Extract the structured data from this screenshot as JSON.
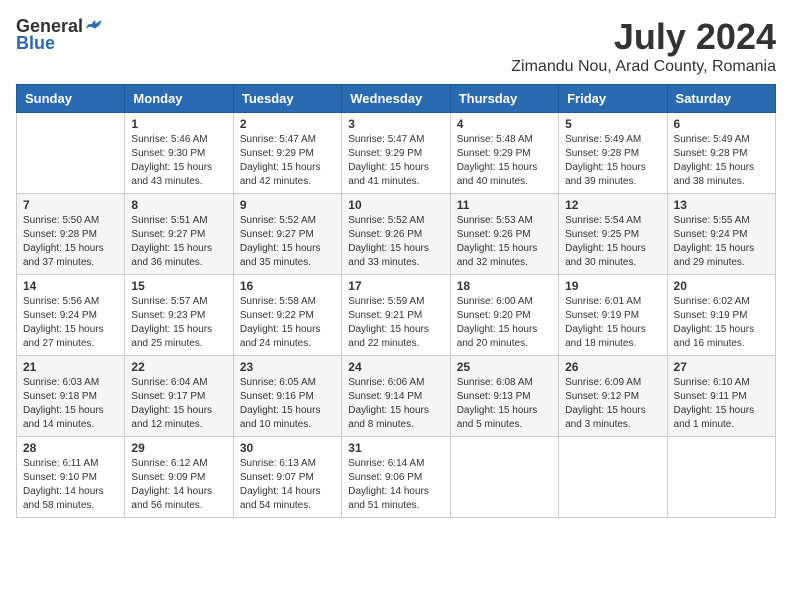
{
  "logo": {
    "general": "General",
    "blue": "Blue"
  },
  "title": {
    "month": "July 2024",
    "location": "Zimandu Nou, Arad County, Romania"
  },
  "weekdays": [
    "Sunday",
    "Monday",
    "Tuesday",
    "Wednesday",
    "Thursday",
    "Friday",
    "Saturday"
  ],
  "weeks": [
    [
      {
        "num": "",
        "info": ""
      },
      {
        "num": "1",
        "info": "Sunrise: 5:46 AM\nSunset: 9:30 PM\nDaylight: 15 hours\nand 43 minutes."
      },
      {
        "num": "2",
        "info": "Sunrise: 5:47 AM\nSunset: 9:29 PM\nDaylight: 15 hours\nand 42 minutes."
      },
      {
        "num": "3",
        "info": "Sunrise: 5:47 AM\nSunset: 9:29 PM\nDaylight: 15 hours\nand 41 minutes."
      },
      {
        "num": "4",
        "info": "Sunrise: 5:48 AM\nSunset: 9:29 PM\nDaylight: 15 hours\nand 40 minutes."
      },
      {
        "num": "5",
        "info": "Sunrise: 5:49 AM\nSunset: 9:28 PM\nDaylight: 15 hours\nand 39 minutes."
      },
      {
        "num": "6",
        "info": "Sunrise: 5:49 AM\nSunset: 9:28 PM\nDaylight: 15 hours\nand 38 minutes."
      }
    ],
    [
      {
        "num": "7",
        "info": "Sunrise: 5:50 AM\nSunset: 9:28 PM\nDaylight: 15 hours\nand 37 minutes."
      },
      {
        "num": "8",
        "info": "Sunrise: 5:51 AM\nSunset: 9:27 PM\nDaylight: 15 hours\nand 36 minutes."
      },
      {
        "num": "9",
        "info": "Sunrise: 5:52 AM\nSunset: 9:27 PM\nDaylight: 15 hours\nand 35 minutes."
      },
      {
        "num": "10",
        "info": "Sunrise: 5:52 AM\nSunset: 9:26 PM\nDaylight: 15 hours\nand 33 minutes."
      },
      {
        "num": "11",
        "info": "Sunrise: 5:53 AM\nSunset: 9:26 PM\nDaylight: 15 hours\nand 32 minutes."
      },
      {
        "num": "12",
        "info": "Sunrise: 5:54 AM\nSunset: 9:25 PM\nDaylight: 15 hours\nand 30 minutes."
      },
      {
        "num": "13",
        "info": "Sunrise: 5:55 AM\nSunset: 9:24 PM\nDaylight: 15 hours\nand 29 minutes."
      }
    ],
    [
      {
        "num": "14",
        "info": "Sunrise: 5:56 AM\nSunset: 9:24 PM\nDaylight: 15 hours\nand 27 minutes."
      },
      {
        "num": "15",
        "info": "Sunrise: 5:57 AM\nSunset: 9:23 PM\nDaylight: 15 hours\nand 25 minutes."
      },
      {
        "num": "16",
        "info": "Sunrise: 5:58 AM\nSunset: 9:22 PM\nDaylight: 15 hours\nand 24 minutes."
      },
      {
        "num": "17",
        "info": "Sunrise: 5:59 AM\nSunset: 9:21 PM\nDaylight: 15 hours\nand 22 minutes."
      },
      {
        "num": "18",
        "info": "Sunrise: 6:00 AM\nSunset: 9:20 PM\nDaylight: 15 hours\nand 20 minutes."
      },
      {
        "num": "19",
        "info": "Sunrise: 6:01 AM\nSunset: 9:19 PM\nDaylight: 15 hours\nand 18 minutes."
      },
      {
        "num": "20",
        "info": "Sunrise: 6:02 AM\nSunset: 9:19 PM\nDaylight: 15 hours\nand 16 minutes."
      }
    ],
    [
      {
        "num": "21",
        "info": "Sunrise: 6:03 AM\nSunset: 9:18 PM\nDaylight: 15 hours\nand 14 minutes."
      },
      {
        "num": "22",
        "info": "Sunrise: 6:04 AM\nSunset: 9:17 PM\nDaylight: 15 hours\nand 12 minutes."
      },
      {
        "num": "23",
        "info": "Sunrise: 6:05 AM\nSunset: 9:16 PM\nDaylight: 15 hours\nand 10 minutes."
      },
      {
        "num": "24",
        "info": "Sunrise: 6:06 AM\nSunset: 9:14 PM\nDaylight: 15 hours\nand 8 minutes."
      },
      {
        "num": "25",
        "info": "Sunrise: 6:08 AM\nSunset: 9:13 PM\nDaylight: 15 hours\nand 5 minutes."
      },
      {
        "num": "26",
        "info": "Sunrise: 6:09 AM\nSunset: 9:12 PM\nDaylight: 15 hours\nand 3 minutes."
      },
      {
        "num": "27",
        "info": "Sunrise: 6:10 AM\nSunset: 9:11 PM\nDaylight: 15 hours\nand 1 minute."
      }
    ],
    [
      {
        "num": "28",
        "info": "Sunrise: 6:11 AM\nSunset: 9:10 PM\nDaylight: 14 hours\nand 58 minutes."
      },
      {
        "num": "29",
        "info": "Sunrise: 6:12 AM\nSunset: 9:09 PM\nDaylight: 14 hours\nand 56 minutes."
      },
      {
        "num": "30",
        "info": "Sunrise: 6:13 AM\nSunset: 9:07 PM\nDaylight: 14 hours\nand 54 minutes."
      },
      {
        "num": "31",
        "info": "Sunrise: 6:14 AM\nSunset: 9:06 PM\nDaylight: 14 hours\nand 51 minutes."
      },
      {
        "num": "",
        "info": ""
      },
      {
        "num": "",
        "info": ""
      },
      {
        "num": "",
        "info": ""
      }
    ]
  ]
}
